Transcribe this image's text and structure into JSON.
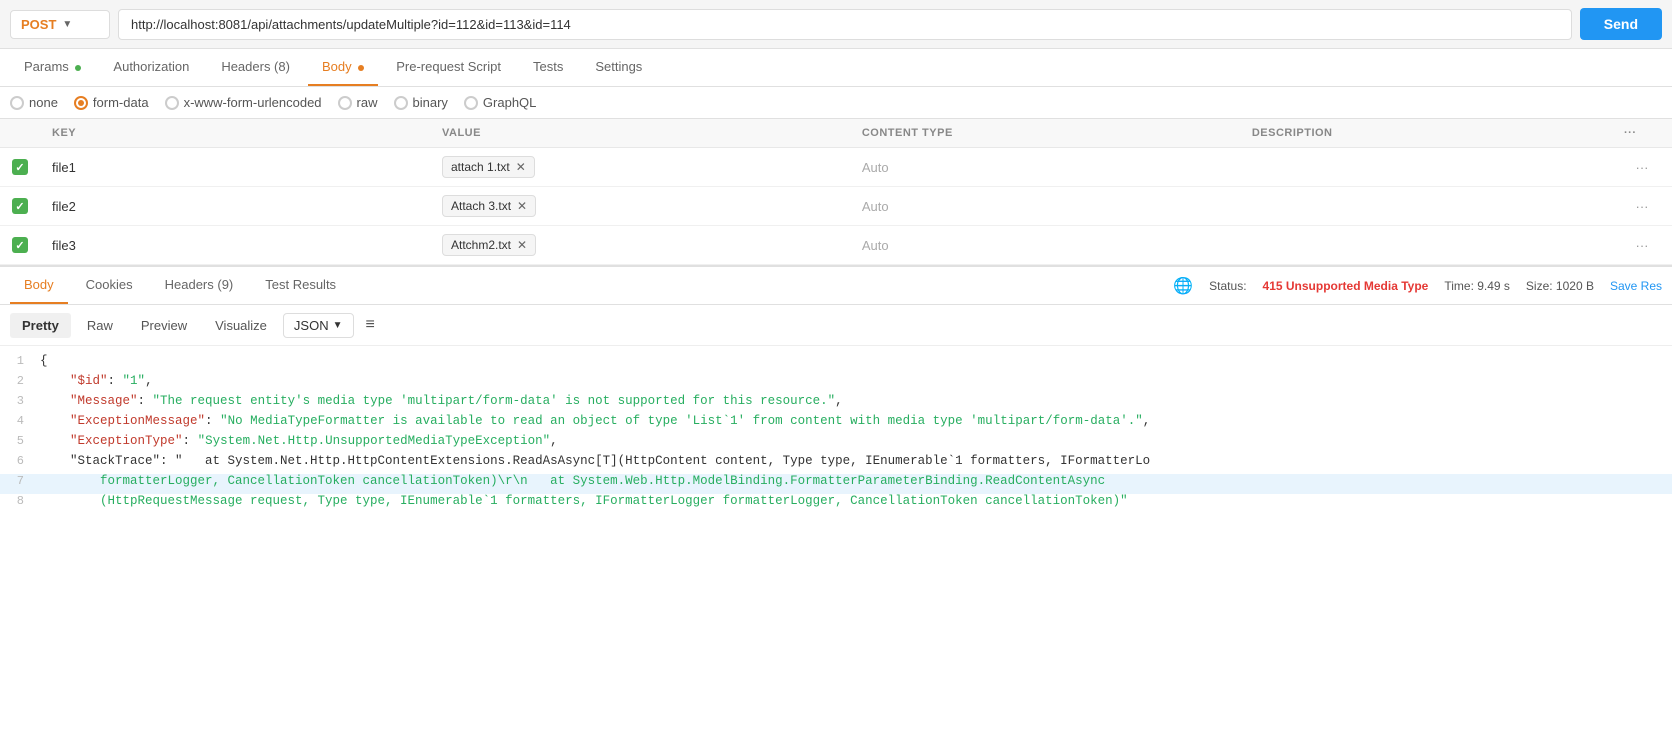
{
  "urlBar": {
    "method": "POST",
    "url": "http://localhost:8081/api/attachments/updateMultiple?id=112&id=113&id=114",
    "sendLabel": "Send"
  },
  "requestTabs": [
    {
      "id": "params",
      "label": "Params",
      "dot": "green",
      "active": false
    },
    {
      "id": "authorization",
      "label": "Authorization",
      "dot": null,
      "active": false
    },
    {
      "id": "headers",
      "label": "Headers (8)",
      "dot": null,
      "active": false
    },
    {
      "id": "body",
      "label": "Body",
      "dot": "orange",
      "active": true
    },
    {
      "id": "prerequest",
      "label": "Pre-request Script",
      "dot": null,
      "active": false
    },
    {
      "id": "tests",
      "label": "Tests",
      "dot": null,
      "active": false
    },
    {
      "id": "settings",
      "label": "Settings",
      "dot": null,
      "active": false
    }
  ],
  "bodyTypes": [
    {
      "id": "none",
      "label": "none",
      "selected": false
    },
    {
      "id": "form-data",
      "label": "form-data",
      "selected": true
    },
    {
      "id": "urlencoded",
      "label": "x-www-form-urlencoded",
      "selected": false
    },
    {
      "id": "raw",
      "label": "raw",
      "selected": false
    },
    {
      "id": "binary",
      "label": "binary",
      "selected": false
    },
    {
      "id": "graphql",
      "label": "GraphQL",
      "selected": false
    }
  ],
  "tableHeaders": {
    "key": "KEY",
    "value": "VALUE",
    "contentType": "CONTENT TYPE",
    "description": "DESCRIPTION"
  },
  "rows": [
    {
      "checked": true,
      "key": "file1",
      "value": "attach 1.txt",
      "contentType": "Auto",
      "description": ""
    },
    {
      "checked": true,
      "key": "file2",
      "value": "Attach 3.txt",
      "contentType": "Auto",
      "description": ""
    },
    {
      "checked": true,
      "key": "file3",
      "value": "Attchm2.txt",
      "contentType": "Auto",
      "description": ""
    }
  ],
  "responseTabs": [
    {
      "id": "body",
      "label": "Body",
      "active": true
    },
    {
      "id": "cookies",
      "label": "Cookies",
      "active": false
    },
    {
      "id": "headers",
      "label": "Headers (9)",
      "active": false
    },
    {
      "id": "testresults",
      "label": "Test Results",
      "active": false
    }
  ],
  "responseStatus": {
    "statusCode": "415",
    "statusText": "Unsupported Media Type",
    "time": "9.49 s",
    "size": "1020 B",
    "saveLabel": "Save Res"
  },
  "formatTabs": [
    {
      "id": "pretty",
      "label": "Pretty",
      "active": true
    },
    {
      "id": "raw",
      "label": "Raw",
      "active": false
    },
    {
      "id": "preview",
      "label": "Preview",
      "active": false
    },
    {
      "id": "visualize",
      "label": "Visualize",
      "active": false
    }
  ],
  "jsonFormat": "JSON",
  "codeLines": [
    {
      "num": 1,
      "content": "{",
      "type": "bracket"
    },
    {
      "num": 2,
      "content": "    \"$id\": \"1\",",
      "type": "kv-str"
    },
    {
      "num": 3,
      "content": "    \"Message\": \"The request entity's media type 'multipart/form-data' is not supported for this resource.\",",
      "type": "kv-str"
    },
    {
      "num": 4,
      "content": "    \"ExceptionMessage\": \"No MediaTypeFormatter is available to read an object of type 'List`1' from content with media type 'multipart/form-data'.\",",
      "type": "kv-str"
    },
    {
      "num": 5,
      "content": "    \"ExceptionType\": \"System.Net.Http.UnsupportedMediaTypeException\",",
      "type": "kv-str"
    },
    {
      "num": 6,
      "content": "    \"StackTrace\": \"   at System.Net.Http.HttpContentExtensions.ReadAsAsync[T](HttpContent content, Type type, IEnumerable`1 formatters, IFormatterLo",
      "type": "kv-str"
    },
    {
      "num": 7,
      "content": "        formatterLogger, CancellationToken cancellationToken)\\r\\n   at System.Web.Http.ModelBinding.FormatterParameterBinding.ReadContentAsync",
      "type": "continuation",
      "highlight": true
    },
    {
      "num": 8,
      "content": "        (HttpRequestMessage request, Type type, IEnumerable`1 formatters, IFormatterLogger formatterLogger, CancellationToken cancellationToken)\"",
      "type": "continuation"
    }
  ]
}
